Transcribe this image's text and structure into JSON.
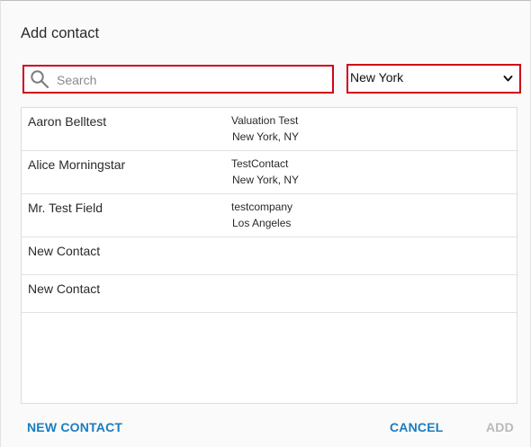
{
  "dialog": {
    "title": "Add contact"
  },
  "search": {
    "placeholder": "Search",
    "value": ""
  },
  "location_select": {
    "selected": "New York"
  },
  "contacts": [
    {
      "name": "Aaron Belltest",
      "company": "Valuation Test",
      "location": "New York, NY"
    },
    {
      "name": "Alice Morningstar",
      "company": "TestContact",
      "location": "New York, NY"
    },
    {
      "name": "Mr. Test Field",
      "company": "testcompany",
      "location": "Los Angeles"
    },
    {
      "name": "New Contact",
      "company": "",
      "location": ""
    },
    {
      "name": "New Contact",
      "company": "",
      "location": ""
    }
  ],
  "footer": {
    "new_contact_label": "NEW CONTACT",
    "cancel_label": "CANCEL",
    "add_label": "ADD"
  },
  "colors": {
    "accent": "#1a7cc0",
    "highlight_border": "#d0021b",
    "disabled": "#b9b9b9"
  }
}
